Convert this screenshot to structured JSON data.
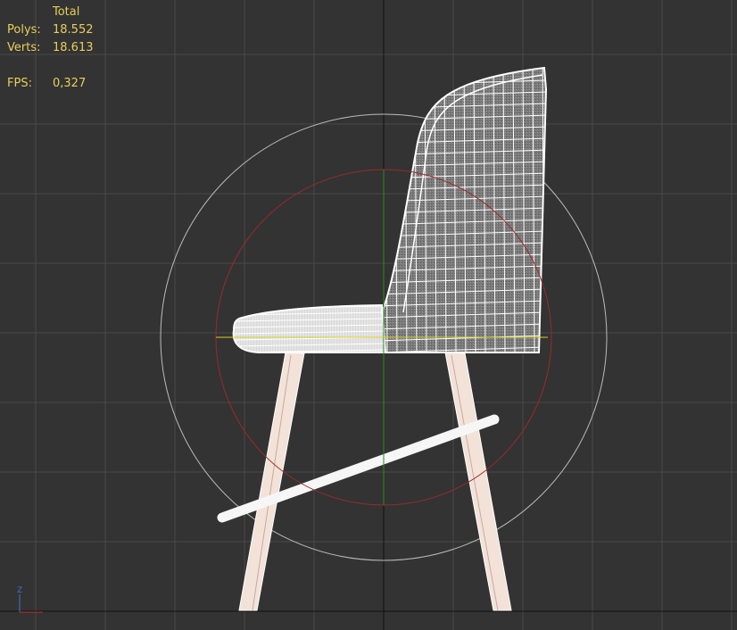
{
  "viewport": {
    "label": "3D viewport - left view (wireframe)",
    "background": "#333333",
    "grid_color": "#4a4a4a",
    "axis_color": "#0f0f0f"
  },
  "stats": {
    "header": "Total",
    "polys_label": "Polys:",
    "polys_value": "18.552",
    "verts_label": "Verts:",
    "verts_value": "18.613",
    "fps_label": "FPS:",
    "fps_value": "0,327",
    "text_color": "#e6cf5a"
  },
  "gizmo": {
    "outer_circle_color": "#bbbbbb",
    "inner_circle_color": "#9a2a2a",
    "x_axis_color": "#d8d020",
    "z_axis_color": "#2a8a2a"
  },
  "axis_tripod": {
    "z_label": "Z",
    "z_color": "#4a6fd0",
    "x_color": "#c83030"
  },
  "object": {
    "name": "chair",
    "wire_color": "#ffffff",
    "leg_color": "#f3e2d8"
  }
}
